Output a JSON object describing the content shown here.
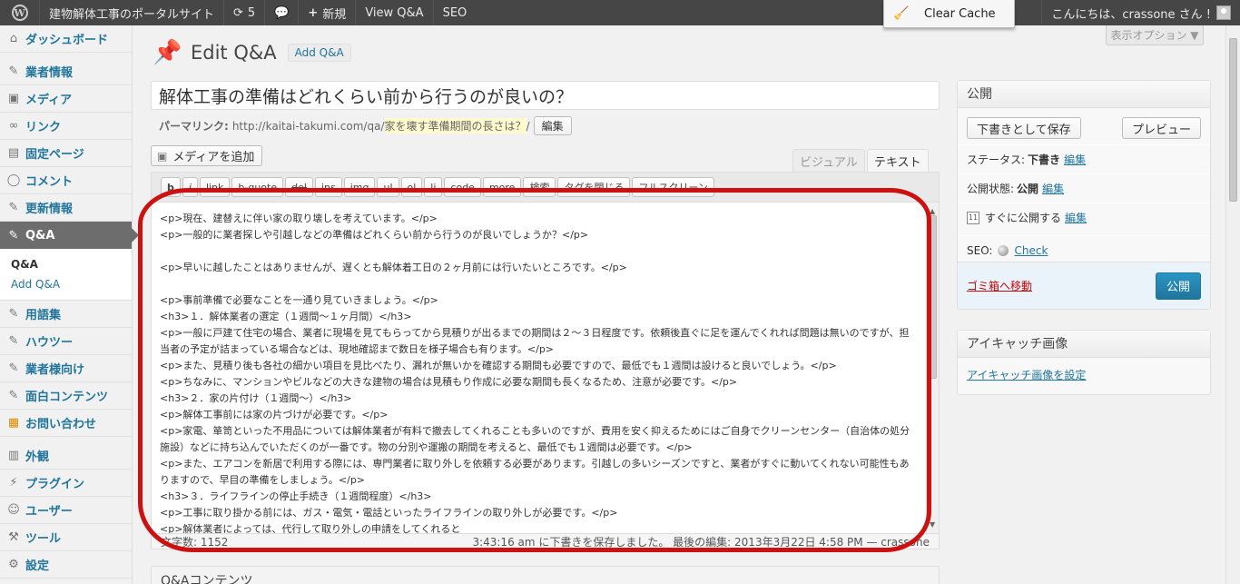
{
  "adminbar": {
    "site_name": "建物解体工事のポータルサイト",
    "updates_count": "5",
    "new_label": "新規",
    "view_label": "View Q&A",
    "seo_label": "SEO",
    "clear_cache": "Clear Cache",
    "greeting": "こんにちは、crassone さん !"
  },
  "sidebar": {
    "items": [
      {
        "label": "ダッシュボード",
        "icon": "dashboard-icon"
      },
      {
        "label": "業者情報",
        "icon": "pin-icon"
      },
      {
        "label": "メディア",
        "icon": "media-icon"
      },
      {
        "label": "リンク",
        "icon": "link-icon"
      },
      {
        "label": "固定ページ",
        "icon": "page-icon"
      },
      {
        "label": "コメント",
        "icon": "comment-icon"
      },
      {
        "label": "更新情報",
        "icon": "pin-icon"
      },
      {
        "label": "Q&A",
        "icon": "pin-icon"
      },
      {
        "label": "用語集",
        "icon": "pin-icon"
      },
      {
        "label": "ハウツー",
        "icon": "pin-icon"
      },
      {
        "label": "業者様向け",
        "icon": "pin-icon"
      },
      {
        "label": "面白コンテンツ",
        "icon": "pin-icon"
      },
      {
        "label": "お問い合わせ",
        "icon": "contact-icon"
      },
      {
        "label": "外観",
        "icon": "appearance-icon"
      },
      {
        "label": "プラグイン",
        "icon": "plugin-icon"
      },
      {
        "label": "ユーザー",
        "icon": "users-icon"
      },
      {
        "label": "ツール",
        "icon": "tools-icon"
      },
      {
        "label": "設定",
        "icon": "settings-icon"
      }
    ],
    "submenu": [
      "Q&A",
      "Add Q&A"
    ]
  },
  "screen_options": "表示オプション ▼",
  "heading": {
    "title": "Edit Q&A",
    "add_new": "Add Q&A"
  },
  "post": {
    "title": "解体工事の準備はどれくらい前から行うのが良いの？",
    "permalink_label": "パーマリンク:",
    "permalink_url": "http://kaitai-takumi.com/qa/",
    "permalink_slug": "家を壊す準備期間の長さは？",
    "permalink_suffix": "/",
    "edit_button": "編集"
  },
  "editor": {
    "add_media": "メディアを追加",
    "tab_visual": "ビジュアル",
    "tab_text": "テキスト",
    "buttons": [
      "b",
      "i",
      "link",
      "b-quote",
      "del",
      "ins",
      "img",
      "ul",
      "ol",
      "li",
      "code",
      "more",
      "検索",
      "タグを閉じる",
      "フルスクリーン"
    ],
    "lines": [
      "<p>現在、建替えに伴い家の取り壊しを考えています。</p>",
      "<p>一般的に業者探しや引越しなどの準備はどれくらい前から行うのが良いでしょうか？</p>",
      "",
      "<p>早いに越したことはありませんが、遅くとも解体着工日の２ヶ月前には行いたいところです。</p>",
      "",
      "<p>事前準備で必要なことを一通り見ていきましょう。</p>",
      "<h3>１．解体業者の選定（１週間～１ヶ月間）</h3>",
      "<p>一般に戸建て住宅の場合、業者に現場を見てもらってから見積りが出るまでの期間は２～３日程度です。依頼後直ぐに足を運んでくれれば問題は無いのですが、担当者の予定が詰まっている場合などは、現地確認まで数日を様子場合も有ります。</p>",
      "<p>また、見積り後も各社の細かい項目を見比べたり、漏れが無いかを確認する期間も必要ですので、最低でも１週間は設けると良いでしょう。</p>",
      "<p>ちなみに、マンションやビルなどの大きな建物の場合は見積もり作成に必要な期間も長くなるため、注意が必要です。</p>",
      "<h3>２．家の片付け（１週間～）</h3>",
      "<p>解体工事前には家の片づけが必要です。</p>",
      "<p>家電、箪笥といった不用品については解体業者が有料で撤去してくれることも多いのですが、費用を安く抑えるためにはご自身でクリーンセンター（自治体の処分施設）などに持ち込んでいただくのが一番です。物の分別や運搬の期間を考えると、最低でも１週間は必要です。</p>",
      "<p>また、エアコンを新居で利用する際には、専門業者に取り外しを依頼する必要があります。引越しの多いシーズンですと、業者がすぐに動いてくれない可能性もありますので、早目の準備をしましょう。</p>",
      "<h3>３．ライフラインの停止手続き（１週間程度）</h3>",
      "<p>工事に取り掛かる前には、ガス・電気・電話といったライフラインの取り外しが必要です。</p>",
      "<p>解体業者によっては、代行して取り外しの申請をしてくれると"
    ],
    "word_count": "文字数: 1152",
    "save_status": "3:43:16 am に下書きを保存しました。 最後の編集: 2013年3月22日 4:58 PM — crassone"
  },
  "qa_box_title": "Q&Aコンテンツ",
  "publish": {
    "title": "公開",
    "save_draft": "下書きとして保存",
    "preview": "プレビュー",
    "status_label": "ステータス:",
    "status_value": "下書き",
    "visibility_label": "公開状態:",
    "visibility_value": "公開",
    "schedule_label": "すぐに公開する",
    "edit_link": "編集",
    "seo_label": "SEO:",
    "seo_check": "Check",
    "trash": "ゴミ箱へ移動",
    "publish_button": "公開"
  },
  "thumbnail": {
    "title": "アイキャッチ画像",
    "set_link": "アイキャッチ画像を設定"
  }
}
